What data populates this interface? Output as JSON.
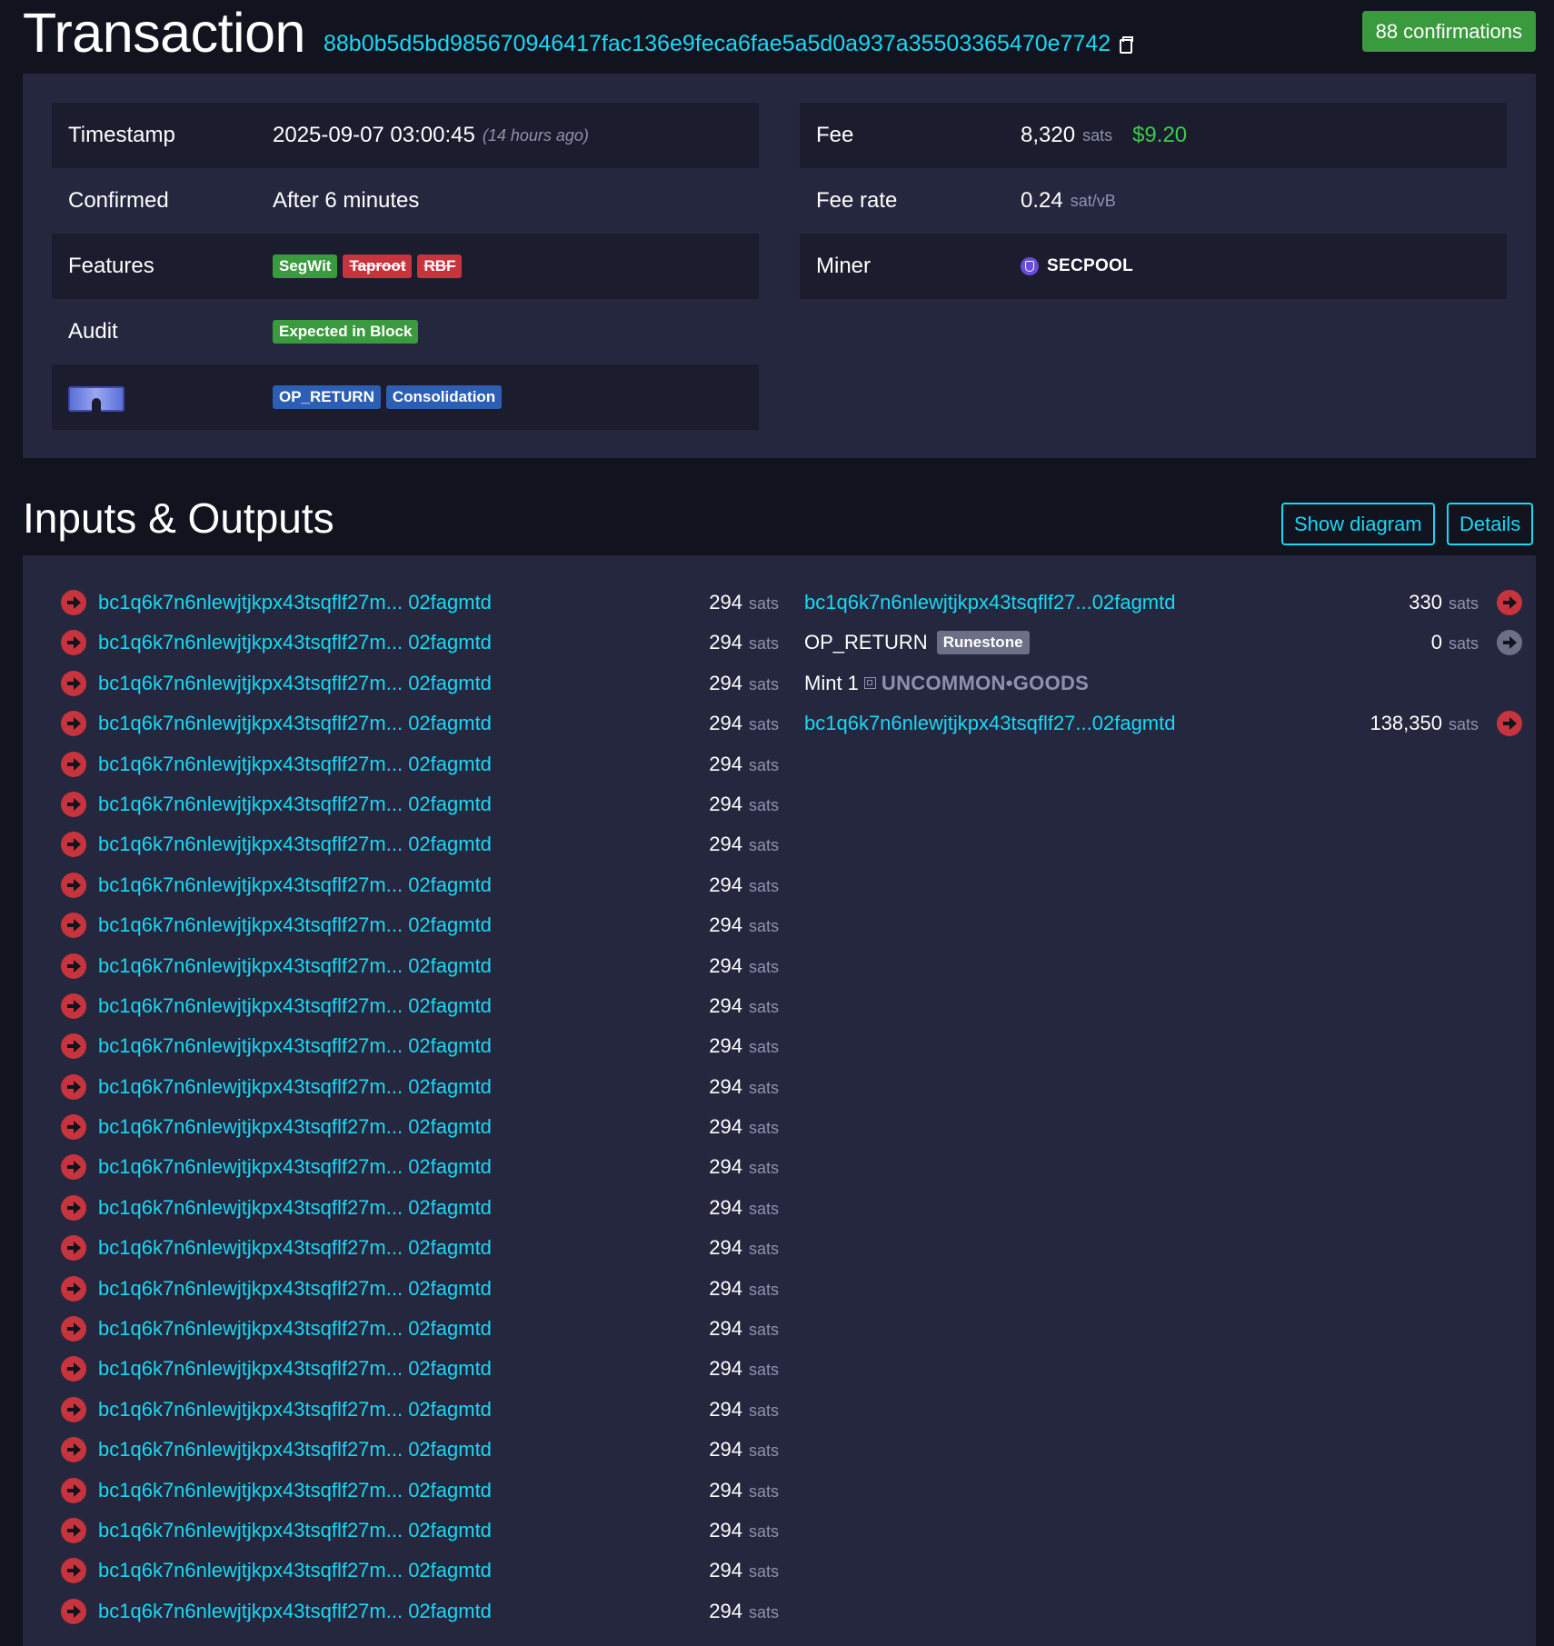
{
  "header": {
    "title": "Transaction",
    "txid": "88b0b5d5bd985670946417fac136e9feca6fae5a5d0a937a35503365470e7742",
    "confirmations": "88 confirmations"
  },
  "details": {
    "timestamp_label": "Timestamp",
    "timestamp_value": "2025-09-07 03:00:45",
    "timestamp_ago": "(14 hours ago)",
    "confirmed_label": "Confirmed",
    "confirmed_value": "After 6 minutes",
    "features_label": "Features",
    "features": [
      "SegWit",
      "Taproot",
      "RBF"
    ],
    "audit_label": "Audit",
    "audit_value": "Expected in Block",
    "tags": [
      "OP_RETURN",
      "Consolidation"
    ],
    "fee_label": "Fee",
    "fee_value": "8,320",
    "fee_unit": "sats",
    "fee_fiat": "$9.20",
    "feerate_label": "Fee rate",
    "feerate_value": "0.24",
    "feerate_unit": "sat/vB",
    "miner_label": "Miner",
    "miner_value": "SECPOOL"
  },
  "io": {
    "title": "Inputs & Outputs",
    "show_diagram": "Show diagram",
    "details_button": "Details",
    "unit": "sats",
    "inputs": [
      {
        "address": "bc1q6k7n6nlewjtjkpx43tsqflf27m... 02fagmtd",
        "amount": "294"
      },
      {
        "address": "bc1q6k7n6nlewjtjkpx43tsqflf27m... 02fagmtd",
        "amount": "294"
      },
      {
        "address": "bc1q6k7n6nlewjtjkpx43tsqflf27m... 02fagmtd",
        "amount": "294"
      },
      {
        "address": "bc1q6k7n6nlewjtjkpx43tsqflf27m... 02fagmtd",
        "amount": "294"
      },
      {
        "address": "bc1q6k7n6nlewjtjkpx43tsqflf27m... 02fagmtd",
        "amount": "294"
      },
      {
        "address": "bc1q6k7n6nlewjtjkpx43tsqflf27m... 02fagmtd",
        "amount": "294"
      },
      {
        "address": "bc1q6k7n6nlewjtjkpx43tsqflf27m... 02fagmtd",
        "amount": "294"
      },
      {
        "address": "bc1q6k7n6nlewjtjkpx43tsqflf27m... 02fagmtd",
        "amount": "294"
      },
      {
        "address": "bc1q6k7n6nlewjtjkpx43tsqflf27m... 02fagmtd",
        "amount": "294"
      },
      {
        "address": "bc1q6k7n6nlewjtjkpx43tsqflf27m... 02fagmtd",
        "amount": "294"
      },
      {
        "address": "bc1q6k7n6nlewjtjkpx43tsqflf27m... 02fagmtd",
        "amount": "294"
      },
      {
        "address": "bc1q6k7n6nlewjtjkpx43tsqflf27m... 02fagmtd",
        "amount": "294"
      },
      {
        "address": "bc1q6k7n6nlewjtjkpx43tsqflf27m... 02fagmtd",
        "amount": "294"
      },
      {
        "address": "bc1q6k7n6nlewjtjkpx43tsqflf27m... 02fagmtd",
        "amount": "294"
      },
      {
        "address": "bc1q6k7n6nlewjtjkpx43tsqflf27m... 02fagmtd",
        "amount": "294"
      },
      {
        "address": "bc1q6k7n6nlewjtjkpx43tsqflf27m... 02fagmtd",
        "amount": "294"
      },
      {
        "address": "bc1q6k7n6nlewjtjkpx43tsqflf27m... 02fagmtd",
        "amount": "294"
      },
      {
        "address": "bc1q6k7n6nlewjtjkpx43tsqflf27m... 02fagmtd",
        "amount": "294"
      },
      {
        "address": "bc1q6k7n6nlewjtjkpx43tsqflf27m... 02fagmtd",
        "amount": "294"
      },
      {
        "address": "bc1q6k7n6nlewjtjkpx43tsqflf27m... 02fagmtd",
        "amount": "294"
      },
      {
        "address": "bc1q6k7n6nlewjtjkpx43tsqflf27m... 02fagmtd",
        "amount": "294"
      },
      {
        "address": "bc1q6k7n6nlewjtjkpx43tsqflf27m... 02fagmtd",
        "amount": "294"
      },
      {
        "address": "bc1q6k7n6nlewjtjkpx43tsqflf27m... 02fagmtd",
        "amount": "294"
      },
      {
        "address": "bc1q6k7n6nlewjtjkpx43tsqflf27m... 02fagmtd",
        "amount": "294"
      },
      {
        "address": "bc1q6k7n6nlewjtjkpx43tsqflf27m... 02fagmtd",
        "amount": "294"
      },
      {
        "address": "bc1q6k7n6nlewjtjkpx43tsqflf27m... 02fagmtd",
        "amount": "294"
      }
    ],
    "outputs": {
      "out1_address": "bc1q6k7n6nlewjtjkpx43tsqflf27...02fagmtd",
      "out1_amount": "330",
      "op_return_label": "OP_RETURN",
      "op_return_badge": "Runestone",
      "op_return_amount": "0",
      "mint_label": "Mint 1",
      "mint_rune": "UNCOMMON•GOODS",
      "out3_address": "bc1q6k7n6nlewjtjkpx43tsqflf27...02fagmtd",
      "out3_amount": "138,350"
    }
  }
}
